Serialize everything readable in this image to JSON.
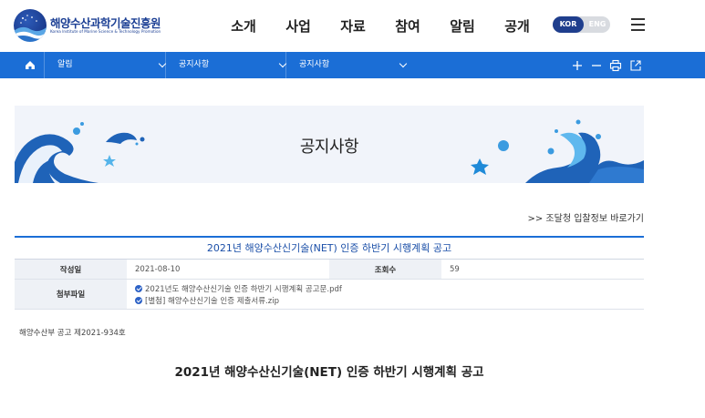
{
  "header": {
    "logo_title": "해양수산과학기술진흥원",
    "logo_subtitle": "Korea Institute of Marine Science & Technology Promotion",
    "nav": [
      "소개",
      "사업",
      "자료",
      "참여",
      "알림",
      "공개"
    ],
    "lang_kor": "KOR",
    "lang_eng": "ENG",
    "menu_icon": "hamburger-menu-icon"
  },
  "breadcrumb": {
    "home_icon": "home-icon",
    "items": [
      "알림",
      "공지사항",
      "공지사항"
    ],
    "tools": [
      "zoom-in-icon",
      "zoom-out-icon",
      "print-icon",
      "share-icon"
    ]
  },
  "banner": {
    "title": "공지사항"
  },
  "procurement_link": ">> 조달청 입찰정보 바로가기",
  "post": {
    "title": "2021년 해양수산신기술(NET) 인증 하반기 시행계획 공고",
    "author_label": "작성일",
    "date": "2021-08-10",
    "views_label": "조회수",
    "views": "59",
    "attach_label": "첨부파일",
    "attachments": [
      "2021년도 해양수산신기술 인증 하반기 시행계획 공고문.pdf",
      "[별첨] 해양수산신기술 인증 제출서류.zip"
    ],
    "notice_number": "해양수산부 공고 제2021-934호",
    "body_title": "2021년 해양수산신기술(NET) 인증 하반기 시행계획 공고"
  },
  "colors": {
    "primary": "#1b6ed6",
    "navy": "#1f3e8d",
    "banner_bg": "#f1f4fa"
  }
}
